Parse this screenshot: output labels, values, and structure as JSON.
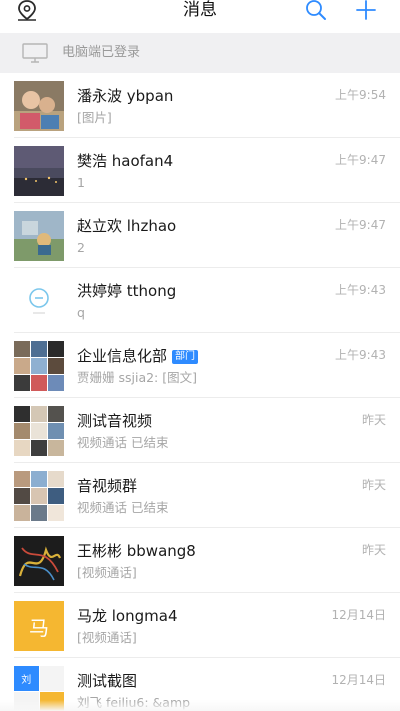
{
  "header": {
    "title": "消息",
    "accent": "#2e8bff"
  },
  "pc_banner": {
    "text": "电脑端已登录"
  },
  "chats": [
    {
      "name": "潘永波 ybpan",
      "preview": "[图片]",
      "time": "上午9:54"
    },
    {
      "name": "樊浩 haofan4",
      "preview": "1",
      "time": "上午9:47"
    },
    {
      "name": "赵立欢 lhzhao",
      "preview": "2",
      "time": "上午9:47"
    },
    {
      "name": "洪婷婷 tthong",
      "preview": "q",
      "time": "上午9:43"
    },
    {
      "name": "企业信息化部",
      "badge": "部门",
      "preview": "贾姗姗 ssjia2: [图文]",
      "time": "上午9:43"
    },
    {
      "name": "测试音视频",
      "preview": "视频通话 已结束",
      "time": "昨天"
    },
    {
      "name": "音视频群",
      "preview": "视频通话 已结束",
      "time": "昨天"
    },
    {
      "name": "王彬彬 bbwang8",
      "preview": "[视频通话]",
      "time": "昨天"
    },
    {
      "name": "马龙 longma4",
      "avatar_text": "马",
      "preview": "[视频通话]",
      "time": "12月14日"
    },
    {
      "name": "测试截图",
      "avatar_text": "刘",
      "preview": "刘飞 feiliu6: &amp",
      "time": "12月14日"
    }
  ]
}
